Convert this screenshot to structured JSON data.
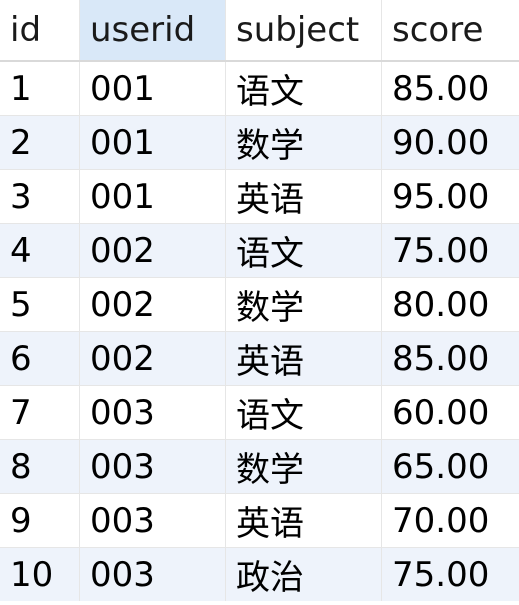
{
  "columns": [
    {
      "key": "id",
      "label": "id"
    },
    {
      "key": "userid",
      "label": "userid"
    },
    {
      "key": "subject",
      "label": "subject"
    },
    {
      "key": "score",
      "label": "score"
    }
  ],
  "rows": [
    {
      "id": "1",
      "userid": "001",
      "subject": "语文",
      "score": "85.00"
    },
    {
      "id": "2",
      "userid": "001",
      "subject": "数学",
      "score": "90.00"
    },
    {
      "id": "3",
      "userid": "001",
      "subject": "英语",
      "score": "95.00"
    },
    {
      "id": "4",
      "userid": "002",
      "subject": "语文",
      "score": "75.00"
    },
    {
      "id": "5",
      "userid": "002",
      "subject": "数学",
      "score": "80.00"
    },
    {
      "id": "6",
      "userid": "002",
      "subject": "英语",
      "score": "85.00"
    },
    {
      "id": "7",
      "userid": "003",
      "subject": "语文",
      "score": "60.00"
    },
    {
      "id": "8",
      "userid": "003",
      "subject": "数学",
      "score": "65.00"
    },
    {
      "id": "9",
      "userid": "003",
      "subject": "英语",
      "score": "70.00"
    },
    {
      "id": "10",
      "userid": "003",
      "subject": "政治",
      "score": "75.00"
    }
  ],
  "colors": {
    "sorted_header": "#d9e8f8",
    "alt_row": "#eef3fb",
    "grid_line": "#e6e6e6"
  }
}
